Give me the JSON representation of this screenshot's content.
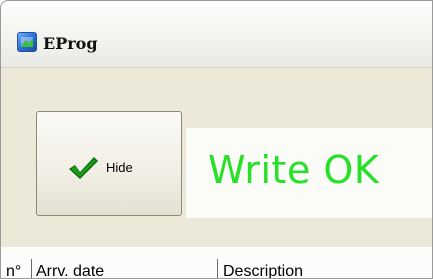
{
  "window": {
    "title": "EProg",
    "icon": "app-icon"
  },
  "toolbar": {
    "hide_label": "Hide",
    "hide_icon": "checkmark-icon"
  },
  "status": {
    "text": "Write OK",
    "color": "#27e027"
  },
  "table": {
    "columns": [
      "n°",
      "Arrv. date",
      "Description"
    ]
  }
}
